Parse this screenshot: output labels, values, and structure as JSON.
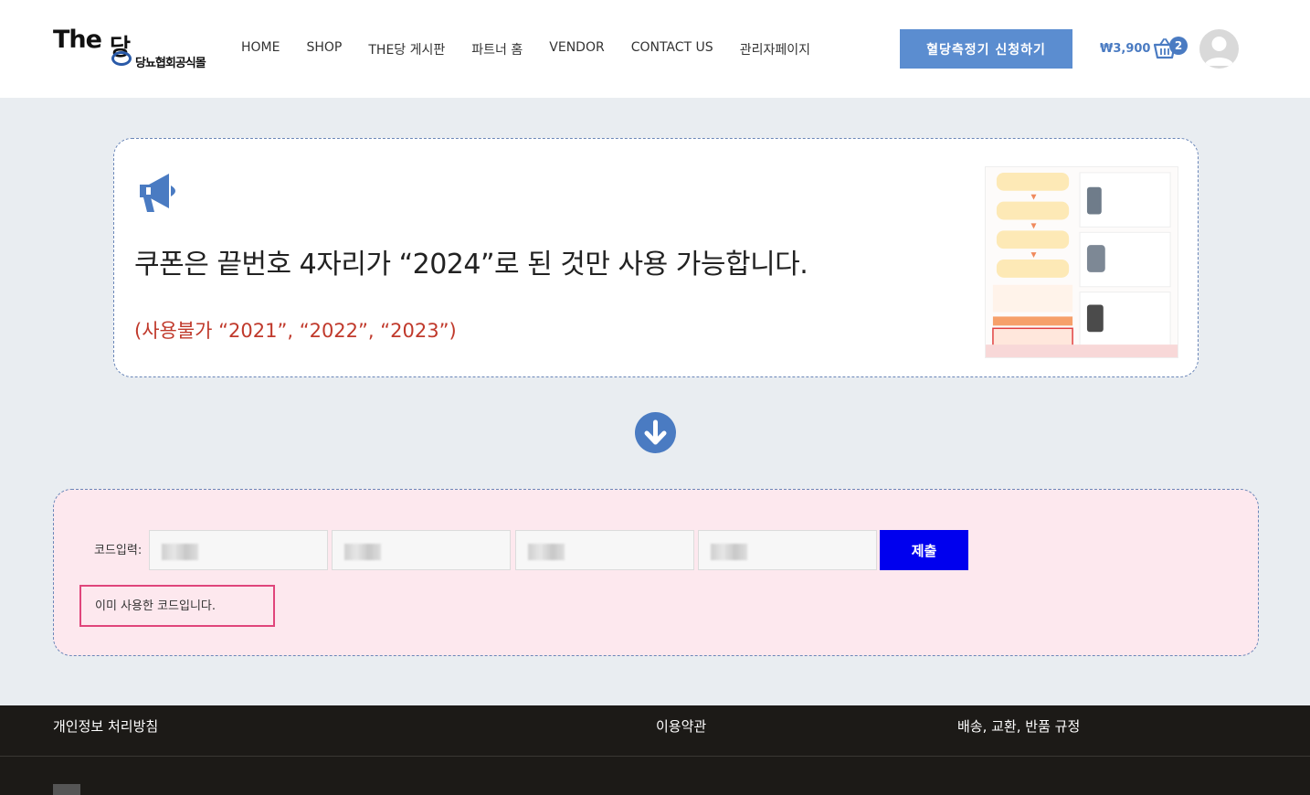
{
  "header": {
    "logo": {
      "primary": "The",
      "secondary": "당",
      "subtitle": "당뇨협회공식몰"
    },
    "nav": [
      "HOME",
      "SHOP",
      "THE당 게시판",
      "파트너 홈",
      "VENDOR",
      "CONTACT US",
      "관리자페이지"
    ],
    "cta_label": "혈당측정기 신청하기",
    "cart_total": "₩3,900",
    "cart_count": "2"
  },
  "notice": {
    "main_text": "쿠폰은 끝번호 4자리가 “2024”로 된 것만 사용 가능합니다.",
    "sub_text": "(사용불가 “2021”, “2022”, “2023”)"
  },
  "code_form": {
    "label": "코드입력:",
    "submit_label": "제출",
    "message": "이미 사용한 코드입니다."
  },
  "footer": {
    "links": [
      "개인정보 처리방침",
      "이용약관",
      "배송, 교환, 반품 규정"
    ]
  },
  "colors": {
    "accent": "#5b8dd0",
    "submit": "#0000ee",
    "error_border": "#e0457b",
    "notice_sub": "#c0392b",
    "footer_bg": "#1c1a17"
  }
}
